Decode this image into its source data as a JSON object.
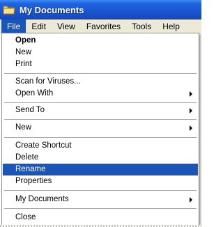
{
  "window": {
    "title": "My Documents",
    "icon": "folder-icon"
  },
  "menubar": {
    "items": [
      {
        "label": "File"
      },
      {
        "label": "Edit"
      },
      {
        "label": "View"
      },
      {
        "label": "Favorites"
      },
      {
        "label": "Tools"
      },
      {
        "label": "Help"
      }
    ],
    "active": "File"
  },
  "file_menu": {
    "open": "Open",
    "new_item": "New",
    "print": "Print",
    "scan": "Scan for Viruses...",
    "open_with": "Open With",
    "send_to": "Send To",
    "new_sub": "New",
    "create_shortcut": "Create Shortcut",
    "delete": "Delete",
    "rename": "Rename",
    "properties": "Properties",
    "my_documents": "My Documents",
    "close": "Close",
    "highlighted": "Rename"
  },
  "colors": {
    "titlebar": "#1a55d0",
    "highlight": "#1c55b8",
    "menubar_bg": "#ece9d8"
  }
}
